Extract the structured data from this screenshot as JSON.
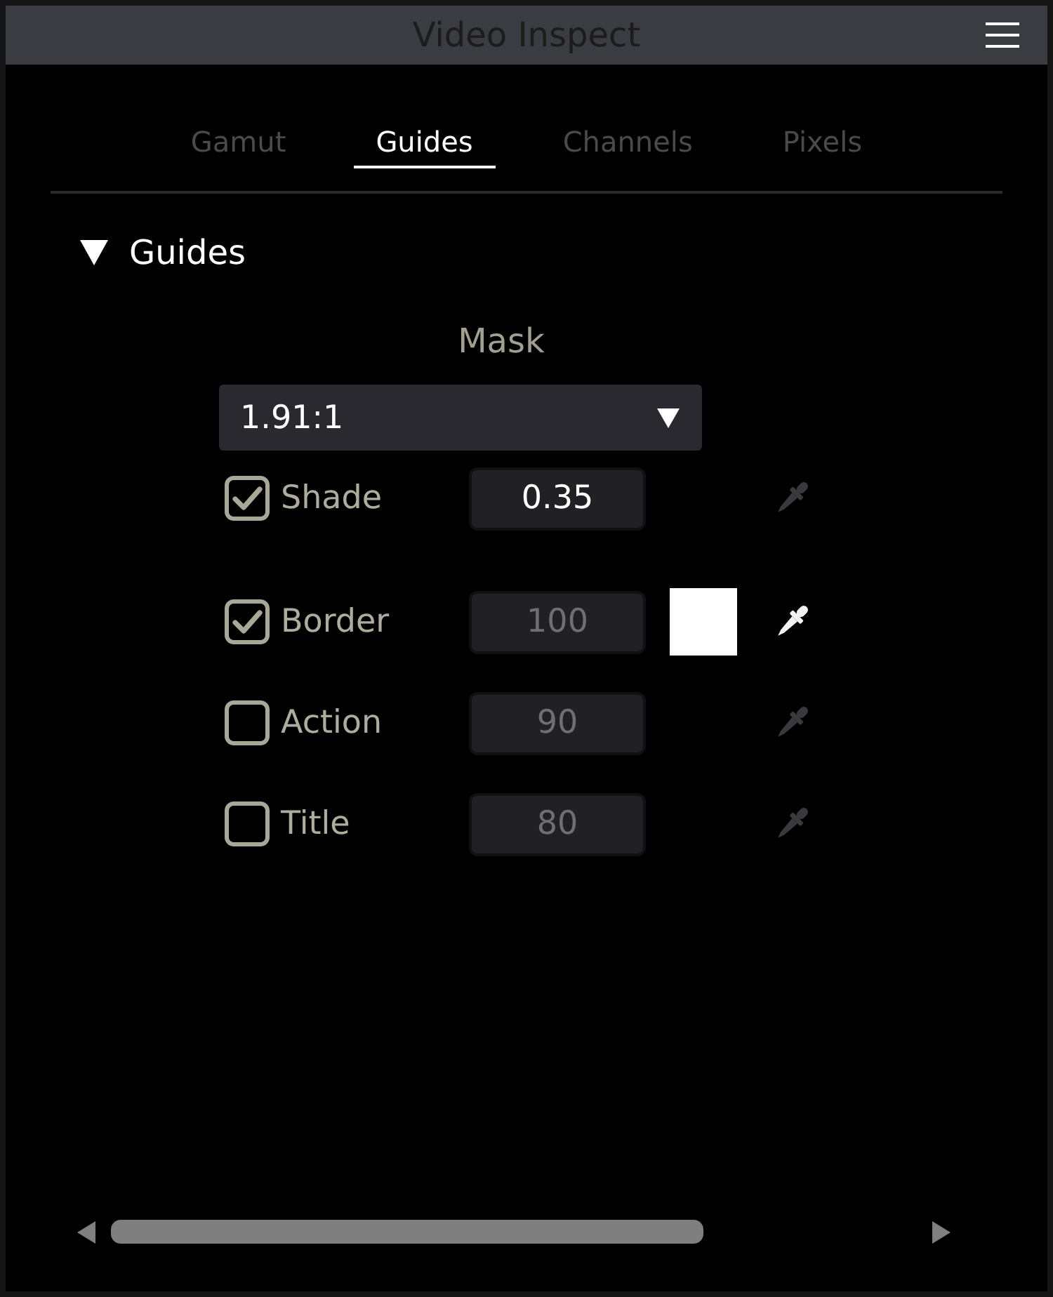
{
  "window": {
    "title": "Video Inspect"
  },
  "tabs": [
    {
      "label": "Gamut",
      "selected": false
    },
    {
      "label": "Guides",
      "selected": true
    },
    {
      "label": "Channels",
      "selected": false
    },
    {
      "label": "Pixels",
      "selected": false
    }
  ],
  "section": {
    "title": "Guides",
    "expanded": true,
    "mask": {
      "label": "Mask",
      "value": "1.91:1"
    },
    "guides": [
      {
        "label": "Shade",
        "checked": true,
        "value": "0.35",
        "value_disabled": false,
        "picker_active": false
      },
      {
        "label": "Border",
        "checked": true,
        "value": "100",
        "value_disabled": true,
        "swatch": {
          "color": "#ffffff"
        },
        "picker_active": true
      },
      {
        "label": "Action",
        "checked": false,
        "value": "90",
        "value_disabled": true,
        "picker_active": false
      },
      {
        "label": "Title",
        "checked": false,
        "value": "80",
        "value_disabled": true,
        "picker_active": false
      }
    ]
  }
}
